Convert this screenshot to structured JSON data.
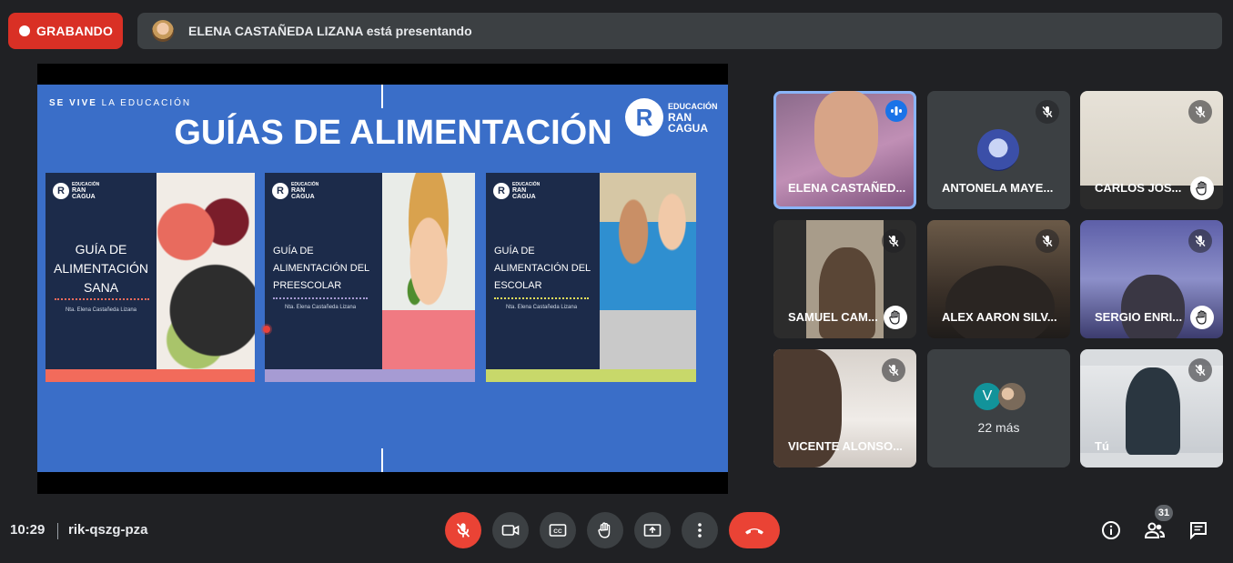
{
  "recording": {
    "label": "GRABANDO"
  },
  "presenter_bar": {
    "text": "ELENA CASTAÑEDA LIZANA está presentando"
  },
  "slide": {
    "tagline_bold": "SE VIVE",
    "tagline_rest": " LA EDUCACIÓN",
    "title": "GUÍAS DE ALIMENTACIÓN",
    "brand": {
      "letter": "R",
      "line1": "EDUCACIÓN",
      "line2": "RAN",
      "line3": "CAGUA"
    },
    "cards": [
      {
        "mini1": "EDUCACIÓN",
        "mini2": "RAN",
        "mini3": "CAGUA",
        "title_l1": "GUÍA DE",
        "title_l2": "ALIMENTACIÓN",
        "title_l3": "SANA",
        "author": "Nta. Elena Castañeda Lizana",
        "accent": "#f26b5b"
      },
      {
        "mini1": "EDUCACIÓN",
        "mini2": "RAN",
        "mini3": "CAGUA",
        "title_l1": "GUÍA DE",
        "title_l2": "ALIMENTACIÓN DEL",
        "title_l3": "PREESCOLAR",
        "author": "Nta. Elena Castañeda Lizana",
        "accent": "#a69bd3"
      },
      {
        "mini1": "EDUCACIÓN",
        "mini2": "RAN",
        "mini3": "CAGUA",
        "title_l1": "GUÍA DE",
        "title_l2": "ALIMENTACIÓN DEL",
        "title_l3": "ESCOLAR",
        "author": "Nta. Elena Castañeda Lizana",
        "accent": "#c8d86a"
      }
    ]
  },
  "participants": [
    {
      "name": "ELENA CASTAÑED...",
      "status": "speaking"
    },
    {
      "name": "ANTONELA MAYE...",
      "status": "muted"
    },
    {
      "name": "CARLOS JOS...",
      "status": "muted-hand"
    },
    {
      "name": "SAMUEL CAM...",
      "status": "muted-hand"
    },
    {
      "name": "ALEX AARON SILV...",
      "status": "muted"
    },
    {
      "name": "SERGIO ENRI...",
      "status": "muted-hand"
    },
    {
      "name": "VICENTE ALONSO...",
      "status": "muted"
    },
    {
      "name": "22 más",
      "initial": "V",
      "status": "more"
    },
    {
      "name": "Tú",
      "status": "muted"
    }
  ],
  "bottom_bar": {
    "time": "10:29",
    "meeting_code": "rik-qszg-pza",
    "participant_count": "31"
  },
  "icons": {
    "mic": "mic-off-icon",
    "camera": "videocam-icon",
    "captions": "closed-caption-icon",
    "hand": "raise-hand-icon",
    "present": "present-screen-icon",
    "more": "more-vert-icon",
    "end": "call-end-icon",
    "info": "info-icon",
    "people": "people-icon",
    "chat": "chat-icon"
  },
  "colors": {
    "accent_red": "#ea4335",
    "tile_bg": "#3c4043",
    "bg": "#202124",
    "slide_blue": "#3a6ec8"
  }
}
